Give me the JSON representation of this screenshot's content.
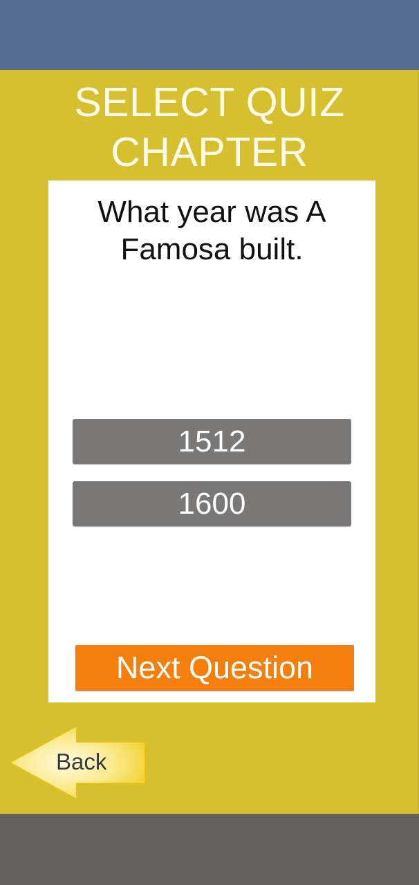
{
  "header": {
    "title_line1": "SELECT QUIZ",
    "title_line2": "CHAPTER"
  },
  "quiz": {
    "question_line1": "What year was A",
    "question_line2": "Famosa built.",
    "answers": [
      {
        "label": "1512"
      },
      {
        "label": "1600"
      }
    ],
    "next_label": "Next Question"
  },
  "navigation": {
    "back_label": "Back",
    "back_icon": "arrow-left-icon"
  },
  "colors": {
    "top_bar": "#566c92",
    "panel": "#d6c02f",
    "bottom_bar": "#67615c",
    "answer_button": "#7a7876",
    "next_button": "#f57f0c",
    "card": "#ffffff"
  }
}
